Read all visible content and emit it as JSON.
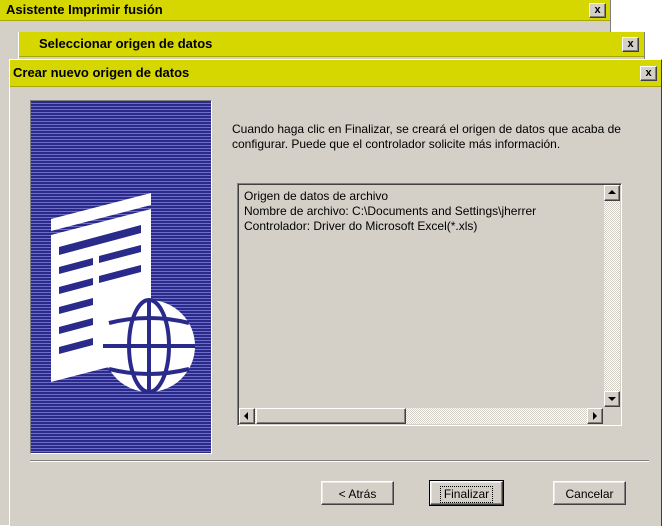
{
  "windows": {
    "wizard": {
      "title": "Asistente Imprimir fusión"
    },
    "select_source": {
      "title": "Seleccionar origen de datos"
    },
    "create_source": {
      "title": "Crear nuevo origen de datos"
    }
  },
  "close_glyph": "x",
  "description": "Cuando haga clic en Finalizar, se creará el origen de datos que acaba de configurar. Puede que el controlador solicite más información.",
  "details": [
    "Origen de datos de archivo",
    "Nombre de archivo: C:\\Documents and Settings\\jherrer",
    "Controlador: Driver do Microsoft Excel(*.xls)"
  ],
  "buttons": {
    "back": "< Atrás",
    "finish": "Finalizar",
    "cancel": "Cancelar"
  },
  "icons": {
    "sidebar": "datasource-globe-icon"
  },
  "colors": {
    "titlebar": "#d6d600",
    "sidebar": "#2a2a8a",
    "face": "#d4d0c8"
  }
}
